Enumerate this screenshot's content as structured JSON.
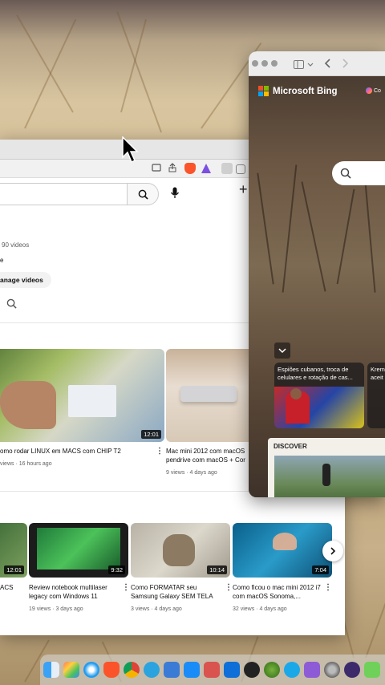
{
  "youtube": {
    "channel_video_count": "90 videos",
    "partial_label": "e",
    "manage_videos_label": "anage videos",
    "top_row": [
      {
        "title": "omo rodar LINUX em MACS com CHIP T2",
        "meta": "views · 16 hours ago",
        "duration": "12:01"
      },
      {
        "title": "Mac mini 2012 com macOS pendrive com macOS + Cor",
        "meta": "9 views · 4 days ago",
        "duration": ""
      }
    ],
    "bottom_row": [
      {
        "title": "ACS",
        "meta": "",
        "duration": "12:01"
      },
      {
        "title": "Review notebook multilaser legacy com Windows 11",
        "meta": "19 views · 3 days ago",
        "duration": "9:32"
      },
      {
        "title": "Como FORMATAR seu Samsung Galaxy SEM TELA",
        "meta": "3 views · 4 days ago",
        "duration": "10:14"
      },
      {
        "title": "Como ficou o mac mini 2012 i7 com macOS Sonoma,...",
        "meta": "32 views · 4 days ago",
        "duration": "7:04"
      }
    ]
  },
  "safari": {
    "bing_logo_text": "Microsoft Bing",
    "copilot_partial": "Co",
    "news_card_title": "Espiões cubanos, troca de celulares e rotação de cas...",
    "news_card_partial": "Krem aceit",
    "discover_label": "DISCOVER"
  },
  "colors": {
    "bing_red": "#f25022",
    "bing_green": "#7fba00",
    "bing_blue": "#00a4ef",
    "bing_yellow": "#ffb900",
    "yt_text": "#0f0f0f"
  }
}
